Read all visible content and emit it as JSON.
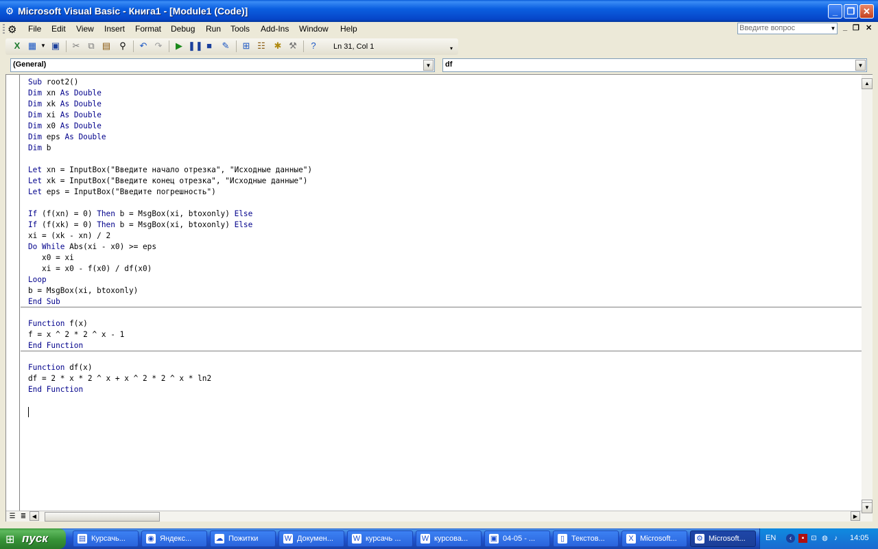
{
  "window": {
    "title": "Microsoft Visual Basic - Книга1 - [Module1 (Code)]",
    "minimize": "_",
    "restore": "❐",
    "close": "✕"
  },
  "menu": {
    "items": [
      "File",
      "Edit",
      "View",
      "Insert",
      "Format",
      "Debug",
      "Run",
      "Tools",
      "Add-Ins",
      "Window",
      "Help"
    ],
    "help_placeholder": "Введите вопрос"
  },
  "toolbar": {
    "icons": [
      "excel-icon",
      "insert-module-icon",
      "save-icon",
      "cut-icon",
      "copy-icon",
      "paste-icon",
      "find-icon",
      "undo-icon",
      "redo-icon",
      "run-icon",
      "break-icon",
      "reset-icon",
      "design-mode-icon",
      "project-explorer-icon",
      "properties-icon",
      "object-browser-icon",
      "toolbox-icon",
      "help-icon"
    ],
    "cursor_position": "Ln 31, Col 1"
  },
  "combos": {
    "object": "(General)",
    "procedure": "df"
  },
  "code": {
    "lines": [
      [
        [
          "kw",
          "Sub"
        ],
        [
          "t",
          " root2()"
        ]
      ],
      [
        [
          "kw",
          "Dim"
        ],
        [
          "t",
          " xn "
        ],
        [
          "kw",
          "As"
        ],
        [
          "t",
          " "
        ],
        [
          "kw",
          "Double"
        ]
      ],
      [
        [
          "kw",
          "Dim"
        ],
        [
          "t",
          " xk "
        ],
        [
          "kw",
          "As"
        ],
        [
          "t",
          " "
        ],
        [
          "kw",
          "Double"
        ]
      ],
      [
        [
          "kw",
          "Dim"
        ],
        [
          "t",
          " xi "
        ],
        [
          "kw",
          "As"
        ],
        [
          "t",
          " "
        ],
        [
          "kw",
          "Double"
        ]
      ],
      [
        [
          "kw",
          "Dim"
        ],
        [
          "t",
          " x0 "
        ],
        [
          "kw",
          "As"
        ],
        [
          "t",
          " "
        ],
        [
          "kw",
          "Double"
        ]
      ],
      [
        [
          "kw",
          "Dim"
        ],
        [
          "t",
          " eps "
        ],
        [
          "kw",
          "As"
        ],
        [
          "t",
          " "
        ],
        [
          "kw",
          "Double"
        ]
      ],
      [
        [
          "kw",
          "Dim"
        ],
        [
          "t",
          " b"
        ]
      ],
      [],
      [
        [
          "kw",
          "Let"
        ],
        [
          "t",
          " xn = InputBox(\"Введите начало отрезка\", \"Исходные данные\")"
        ]
      ],
      [
        [
          "kw",
          "Let"
        ],
        [
          "t",
          " xk = InputBox(\"Введите конец отрезка\", \"Исходные данные\")"
        ]
      ],
      [
        [
          "kw",
          "Let"
        ],
        [
          "t",
          " eps = InputBox(\"Введите погрешность\")"
        ]
      ],
      [],
      [
        [
          "kw",
          "If"
        ],
        [
          "t",
          " (f(xn) = 0) "
        ],
        [
          "kw",
          "Then"
        ],
        [
          "t",
          " b = MsgBox(xi, btoxonly) "
        ],
        [
          "kw",
          "Else"
        ]
      ],
      [
        [
          "kw",
          "If"
        ],
        [
          "t",
          " (f(xk) = 0) "
        ],
        [
          "kw",
          "Then"
        ],
        [
          "t",
          " b = MsgBox(xi, btoxonly) "
        ],
        [
          "kw",
          "Else"
        ]
      ],
      [
        [
          "t",
          "xi = (xk - xn) / 2"
        ]
      ],
      [
        [
          "kw",
          "Do"
        ],
        [
          "t",
          " "
        ],
        [
          "kw",
          "While"
        ],
        [
          "t",
          " Abs(xi - x0) >= eps"
        ]
      ],
      [
        [
          "t",
          "   x0 = xi"
        ]
      ],
      [
        [
          "t",
          "   xi = x0 - f(x0) / df(x0)"
        ]
      ],
      [
        [
          "kw",
          "Loop"
        ]
      ],
      [
        [
          "t",
          "b = MsgBox(xi, btoxonly)"
        ]
      ],
      [
        [
          "kw",
          "End Sub"
        ]
      ],
      [],
      [
        [
          "kw",
          "Function"
        ],
        [
          "t",
          " f(x)"
        ]
      ],
      [
        [
          "t",
          "f = x ^ 2 * 2 ^ x - 1"
        ]
      ],
      [
        [
          "kw",
          "End Function"
        ]
      ],
      [],
      [
        [
          "kw",
          "Function"
        ],
        [
          "t",
          " df(x)"
        ]
      ],
      [
        [
          "t",
          "df = 2 * x * 2 ^ x + x ^ 2 * 2 ^ x * ln2"
        ]
      ],
      [
        [
          "kw",
          "End Function"
        ]
      ]
    ]
  },
  "taskbar": {
    "start": "пуск",
    "tasks": [
      {
        "label": "Курсачь...",
        "icon": "folder-icon",
        "glyph": "▤"
      },
      {
        "label": "Яндекс...",
        "icon": "chrome-icon",
        "glyph": "◉"
      },
      {
        "label": "Пожитки",
        "icon": "app-icon",
        "glyph": "☁"
      },
      {
        "label": "Докумен...",
        "icon": "word-icon",
        "glyph": "W"
      },
      {
        "label": "курсачь ...",
        "icon": "word-icon",
        "glyph": "W"
      },
      {
        "label": "курсова...",
        "icon": "word-icon",
        "glyph": "W"
      },
      {
        "label": "04-05 - ...",
        "icon": "image-icon",
        "glyph": "▣"
      },
      {
        "label": "Текстов...",
        "icon": "notepad-icon",
        "glyph": "▯"
      },
      {
        "label": "Microsoft...",
        "icon": "excel-icon",
        "glyph": "X"
      },
      {
        "label": "Microsoft...",
        "icon": "vba-icon",
        "glyph": "⚙",
        "active": true
      }
    ],
    "lang": "EN",
    "clock": "14:05"
  }
}
